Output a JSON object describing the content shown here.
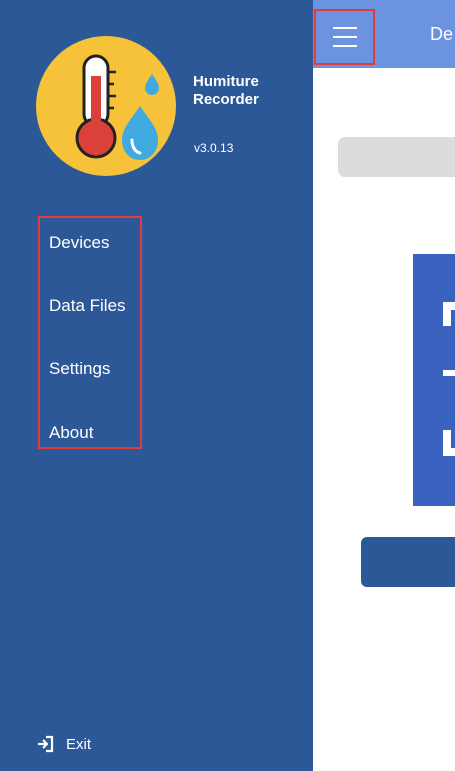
{
  "drawer": {
    "app_name": "Humiture\nRecorder",
    "app_version": "v3.0.13",
    "nav_items": [
      {
        "label": "Devices"
      },
      {
        "label": "Data Files"
      },
      {
        "label": "Settings"
      },
      {
        "label": "About"
      }
    ],
    "exit_label": "Exit"
  },
  "topbar": {
    "title": "De"
  },
  "colors": {
    "drawer_bg": "#2d5898",
    "topbar_bg": "#6b93df",
    "highlight": "#e23b3b",
    "logo_bg": "#f5c23a"
  },
  "icons": {
    "menu": "hamburger-icon",
    "exit": "exit-icon",
    "logo": "thermometer-droplet-icon"
  }
}
